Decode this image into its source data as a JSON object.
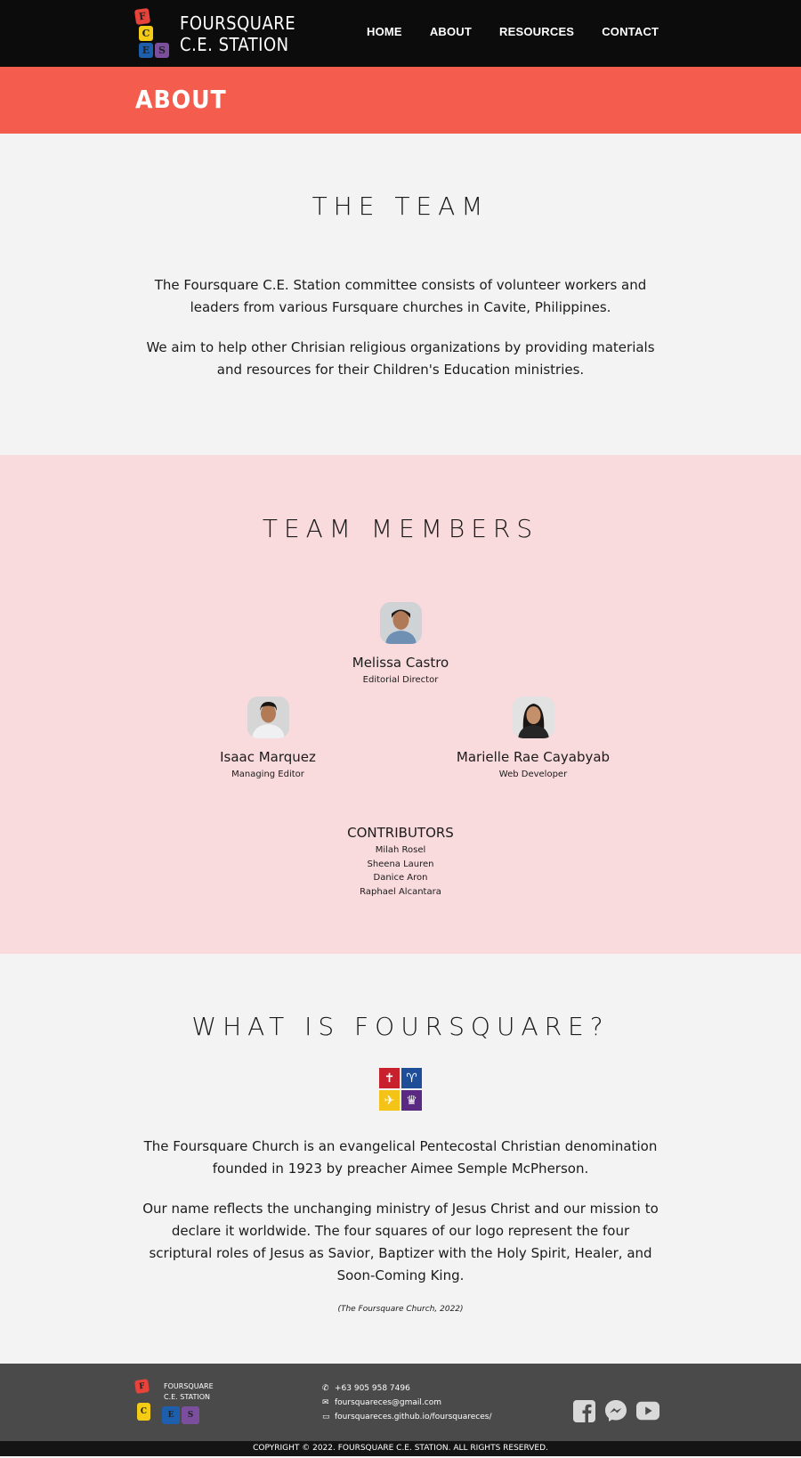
{
  "header": {
    "logo_line1": "FOURSQUARE",
    "logo_line2": "C.E. STATION",
    "logo_letters": [
      "F",
      "C",
      "E",
      "S"
    ],
    "nav": [
      "HOME",
      "ABOUT",
      "RESOURCES",
      "CONTACT"
    ]
  },
  "banner": {
    "title": "ABOUT"
  },
  "team": {
    "title": "THE TEAM",
    "p1": "The Foursquare C.E. Station committee consists of volunteer workers and leaders from various Fursquare churches in Cavite, Philippines.",
    "p2": "We aim to help other Chrisian religious organizations by providing materials and resources for their Children's Education ministries."
  },
  "members": {
    "title": "TEAM MEMBERS",
    "list": [
      {
        "name": "Melissa Castro",
        "role": "Editorial Director"
      },
      {
        "name": "Isaac Marquez",
        "role": "Managing Editor"
      },
      {
        "name": "Marielle Rae Cayabyab",
        "role": "Web Developer"
      }
    ],
    "contributors_title": "CONTRIBUTORS",
    "contributors": [
      "Milah Rosel",
      "Sheena Lauren",
      "Danice Aron",
      "Raphael Alcantara"
    ]
  },
  "foursquare": {
    "title": "WHAT IS FOURSQUARE?",
    "p1": "The Foursquare Church is an evangelical Pentecostal Christian denomination founded in 1923 by preacher Aimee Semple McPherson.",
    "p2": "Our name reflects the unchanging ministry of Jesus Christ and our mission to declare it worldwide. The four squares of our logo represent the four scriptural roles of Jesus as Savior, Baptizer with the Holy Spirit, Healer, and Soon-Coming King.",
    "citation": "(The Foursquare Church, 2022)"
  },
  "footer": {
    "logo_line1": "FOURSQUARE",
    "logo_line2": "C.E. STATION",
    "phone": "+63 905 958 7496",
    "email": "foursquareces@gmail.com",
    "website": "foursquareces.github.io/foursquareces/",
    "copyright": "COPYRIGHT © 2022. FOURSQUARE C.E. STATION. ALL RIGHTS RESERVED."
  },
  "colors": {
    "navbar": "#0c0c0c",
    "banner": "#f45d4d",
    "members_bg": "#f9dadd",
    "footer": "#4a4a4a",
    "red": "#e8433a",
    "yellow": "#f5cc15",
    "blue": "#1e5fad",
    "purple": "#7c4f9e"
  }
}
